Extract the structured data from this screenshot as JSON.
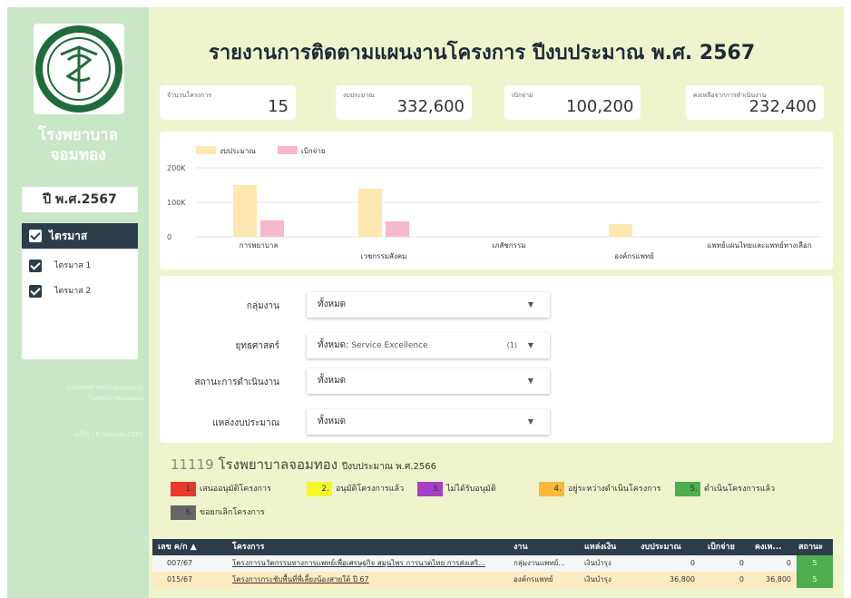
{
  "colors": {
    "background": "#eff4cd",
    "sidebar": "#c9e6c6",
    "dark": "#2d3c4a",
    "budget": "#fde8b0",
    "spent": "#f7b8cb"
  },
  "sidebar": {
    "hospital_line1": "โรงพยาบาล",
    "hospital_line2": "จอมทอง",
    "year": "ปี พ.ศ.2567",
    "quarter_header": "ไตรมาส",
    "quarters": [
      "ไตรมาส 1",
      "ไตรมาส 2"
    ],
    "note1": "งานยุทธศาสตร์และแผนงาน",
    "note2": "โรงพยาบาลจอมทอง",
    "note3": "แก้ไข : 9 กันยายน 2567"
  },
  "header": {
    "title": "รายงานการติดตามแผนงานโครงการ ปีงบประมาณ พ.ศ. 2567"
  },
  "kpis": [
    {
      "label": "จำนวนโครงการ",
      "value": "15"
    },
    {
      "label": "งบประมาณ",
      "value": "332,600"
    },
    {
      "label": "เบิกจ่าย",
      "value": "100,200"
    },
    {
      "label": "คงเหลือจากการดำเนินงาน",
      "value": "232,400"
    }
  ],
  "chart_data": {
    "type": "bar",
    "categories": [
      "การพยาบาล",
      "เวชกรรมสังคม",
      "เภสัชกรรม",
      "องค์กรแพทย์",
      "แพทย์แผนไทยและแพทย์ทางเลือก"
    ],
    "series": [
      {
        "name": "งบประมาณ",
        "values": [
          150000,
          140000,
          0,
          36800,
          0
        ],
        "color": "#fde8b0"
      },
      {
        "name": "เบิกจ่าย",
        "values": [
          48000,
          45000,
          0,
          0,
          0
        ],
        "color": "#f7b8cb"
      }
    ],
    "ylim": [
      0,
      200000
    ],
    "yticks": [
      "0",
      "100K",
      "200K"
    ],
    "legend": "top-left",
    "grid": true
  },
  "filters": [
    {
      "label": "กลุ่มงาน",
      "value": "ทั้งหมด",
      "sub": "",
      "count": ""
    },
    {
      "label": "ยุทธศาสตร์",
      "value": "ทั้งหมด:",
      "sub": " Service Excellence",
      "count": "(1)"
    },
    {
      "label": "สถานะการดำเนินงาน",
      "value": "ทั้งหมด",
      "sub": "",
      "count": ""
    },
    {
      "label": "แหล่งงบประมาณ",
      "value": "ทั้งหมด",
      "sub": "",
      "count": ""
    }
  ],
  "section": {
    "code": "11119",
    "name": "โรงพยาบาลจอมทอง",
    "sub": "ปีงบประมาณ พ.ศ.2566"
  },
  "statuses": [
    {
      "num": "1.",
      "label": "เสนออนุมัติโครงการ",
      "color": "#e8382c"
    },
    {
      "num": "2.",
      "label": "อนุมัติโครงการแล้ว",
      "color": "#f4f92a"
    },
    {
      "num": "3.",
      "label": "ไม่ได้รับอนุมัติ",
      "color": "#a53fc6"
    },
    {
      "num": "4.",
      "label": "อยู่ระหว่างดำเนินโครงการ",
      "color": "#f6b938"
    },
    {
      "num": "5.",
      "label": "ดำเนินโครงการแล้ว",
      "color": "#4cae4c"
    },
    {
      "num": "6.",
      "label": "ขอยกเลิกโครงการ",
      "color": "#666666"
    }
  ],
  "table": {
    "headers": [
      "เลข ค/ก ▲",
      "โครงการ",
      "งาน",
      "แหล่งเงิน",
      "งบประมาณ",
      "เบิกจ่าย",
      "คงเห...",
      "สถานะ"
    ],
    "rows": [
      {
        "id": "007/67",
        "project": "โครงการนวัตกรรมทางการแพทย์เพื่อเศรษฐกิจ สมุนไพร การนวดไทย การส่งเสริ...",
        "dept": "กลุ่มงานแพทย์...",
        "source": "เงินบำรุง",
        "budget": "0",
        "spent": "0",
        "remain": "0",
        "status": "5"
      },
      {
        "id": "015/67",
        "project": "โครงการกระชับพื้นที่พี่เลี้ยงน้องสายใต้ ปี 67",
        "dept": "องค์กรแพทย์",
        "source": "เงินบำรุง",
        "budget": "36,800",
        "spent": "0",
        "remain": "36,800",
        "status": "5"
      }
    ]
  }
}
